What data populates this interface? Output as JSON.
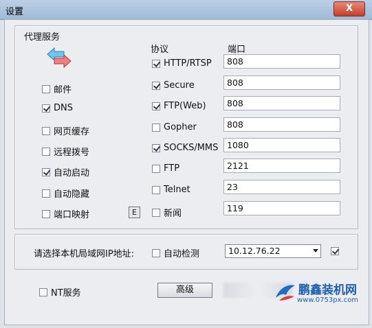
{
  "window": {
    "title": "设置",
    "close_label": "X"
  },
  "proxy": {
    "legend": "代理服务",
    "protocol_header": "协议",
    "port_header": "端口",
    "services": [
      {
        "label": "邮件",
        "checked": false
      },
      {
        "label": "DNS",
        "checked": true
      },
      {
        "label": "网页缓存",
        "checked": false
      },
      {
        "label": "远程拨号",
        "checked": false
      },
      {
        "label": "自动启动",
        "checked": true
      },
      {
        "label": "自动隐藏",
        "checked": false
      },
      {
        "label": "端口映射",
        "checked": false
      }
    ],
    "mapping_button_label": "E",
    "protocols": [
      {
        "label": "HTTP/RTSP",
        "checked": true,
        "port": "808"
      },
      {
        "label": "Secure",
        "checked": true,
        "port": "808"
      },
      {
        "label": "FTP(Web)",
        "checked": true,
        "port": "808"
      },
      {
        "label": "Gopher",
        "checked": false,
        "port": "808"
      },
      {
        "label": "SOCKS/MMS",
        "checked": true,
        "port": "1080"
      },
      {
        "label": "FTP",
        "checked": false,
        "port": "2121"
      },
      {
        "label": "Telnet",
        "checked": false,
        "port": "23"
      },
      {
        "label": "新闻",
        "checked": false,
        "port": "119"
      }
    ]
  },
  "lan": {
    "prompt": "请选择本机局域网IP地址:",
    "auto_detect_label": "自动检测",
    "auto_detect_checked": false,
    "ip_selected": "10.12.76.22",
    "extra_checked": true
  },
  "footer": {
    "nt_service_label": "NT服务",
    "nt_service_checked": false,
    "advanced_label": "高级"
  },
  "watermark": {
    "brand": "鹏鑫装机网",
    "url": "www.0753px.com"
  }
}
